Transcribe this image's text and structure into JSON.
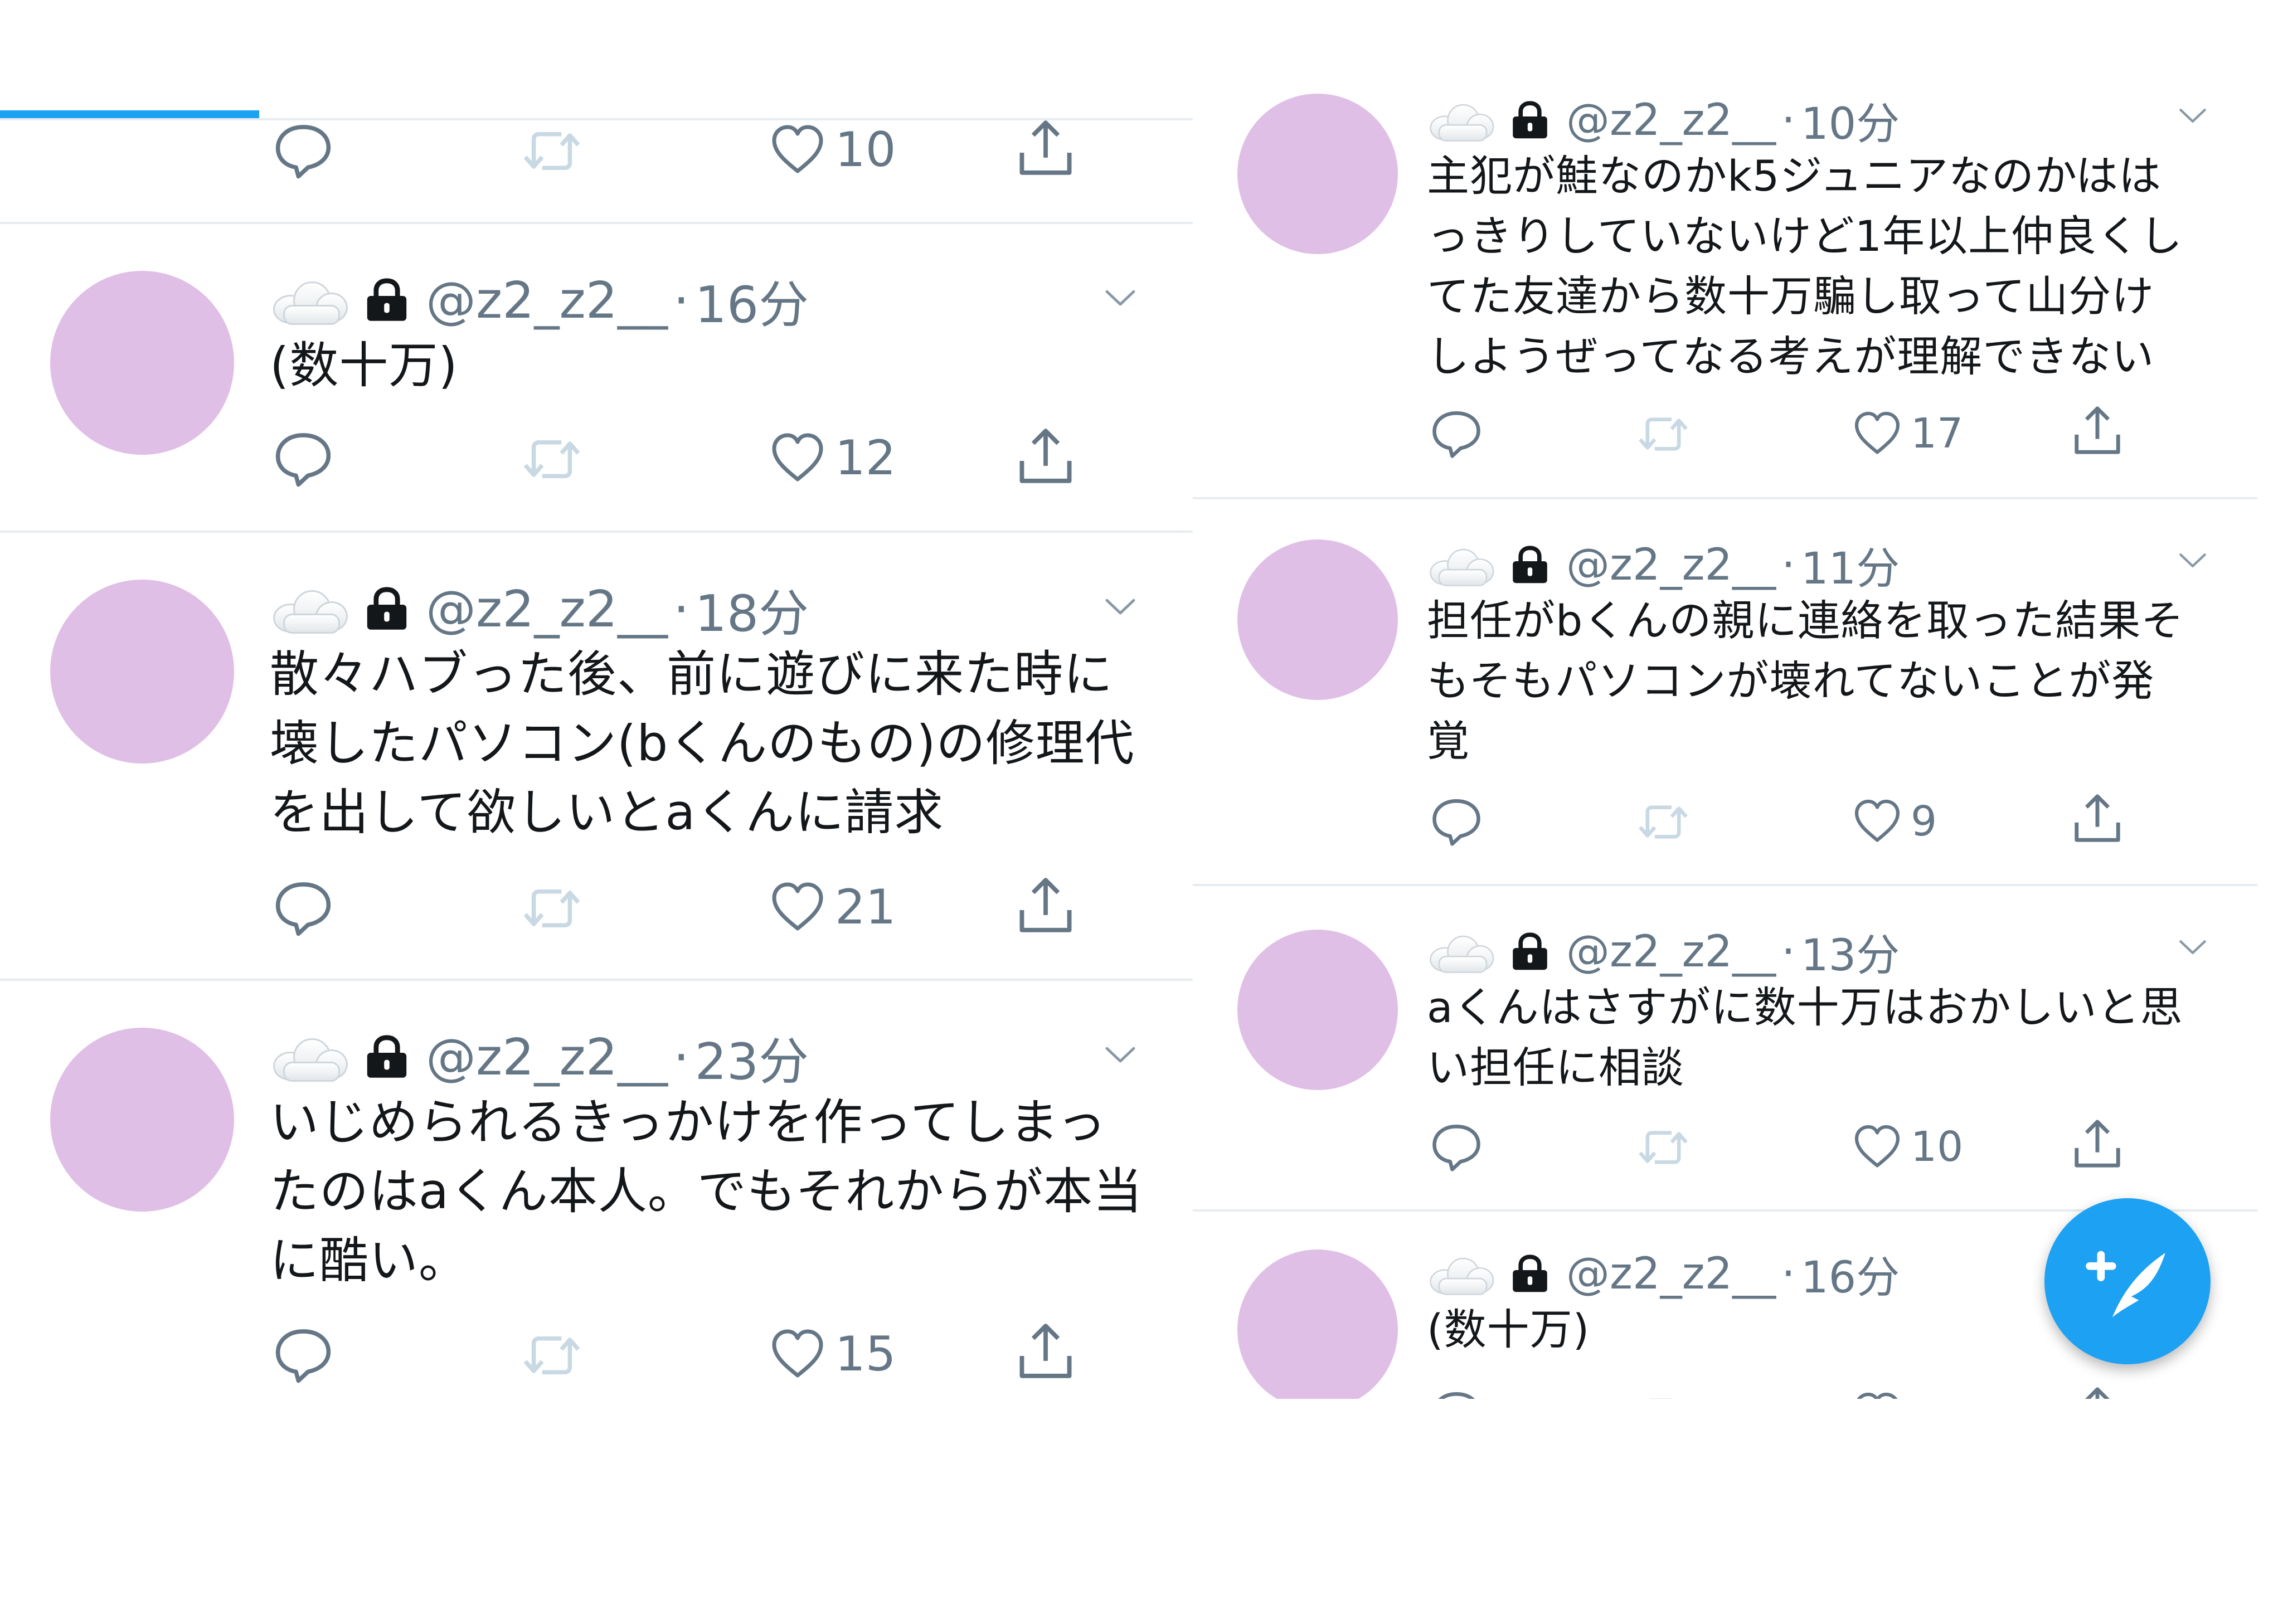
{
  "left_column": {
    "top_partial_tweet": {
      "like_count": "10"
    },
    "tweets": [
      {
        "handle": "@z2_z2__",
        "time": "16分",
        "text": "(数十万)",
        "like_count": "12"
      },
      {
        "handle": "@z2_z2__",
        "time": "18分",
        "text": "散々ハブった後、前に遊びに来た時に\n壊したパソコン(bくんのもの)の修理代\nを出して欲しいとaくんに請求",
        "like_count": "21"
      },
      {
        "handle": "@z2_z2__",
        "time": "23分",
        "text": "いじめられるきっかけを作ってしまっ\nたのはaくん本人。でもそれからが本当\nに酷い。",
        "like_count": "15"
      }
    ]
  },
  "right_column": {
    "tweets": [
      {
        "handle": "@z2_z2__",
        "time": "10分",
        "text": "主犯が鮭なのかk5ジュニアなのかはは\nっきりしていないけど1年以上仲良くし\nてた友達から数十万騙し取って山分け\nしようぜってなる考えが理解できない",
        "like_count": "17"
      },
      {
        "handle": "@z2_z2__",
        "time": "11分",
        "text": "担任がbくんの親に連絡を取った結果そ\nもそもパソコンが壊れてないことが発\n覚",
        "like_count": "9"
      },
      {
        "handle": "@z2_z2__",
        "time": "13分",
        "text": "aくんはさすがに数十万はおかしいと思\nい担任に相談",
        "like_count": "10"
      },
      {
        "handle": "@z2_z2__",
        "time": "16分",
        "text": "(数十万)"
      }
    ]
  },
  "icons": {
    "reply": "speech-bubble-icon",
    "retweet": "retweet-icon",
    "like": "heart-outline-icon",
    "share": "share-up-arrow-icon",
    "lock": "lock-icon",
    "cloud": "cloud-emoji-icon",
    "more": "chevron-down-icon",
    "compose": "compose-quill-icon"
  },
  "colors": {
    "accent": "#1da1f2",
    "avatar": "#e0bfe6",
    "muted_text": "#657786",
    "divider": "#e6ecf0",
    "retweet_disabled": "#c9d9e4"
  }
}
